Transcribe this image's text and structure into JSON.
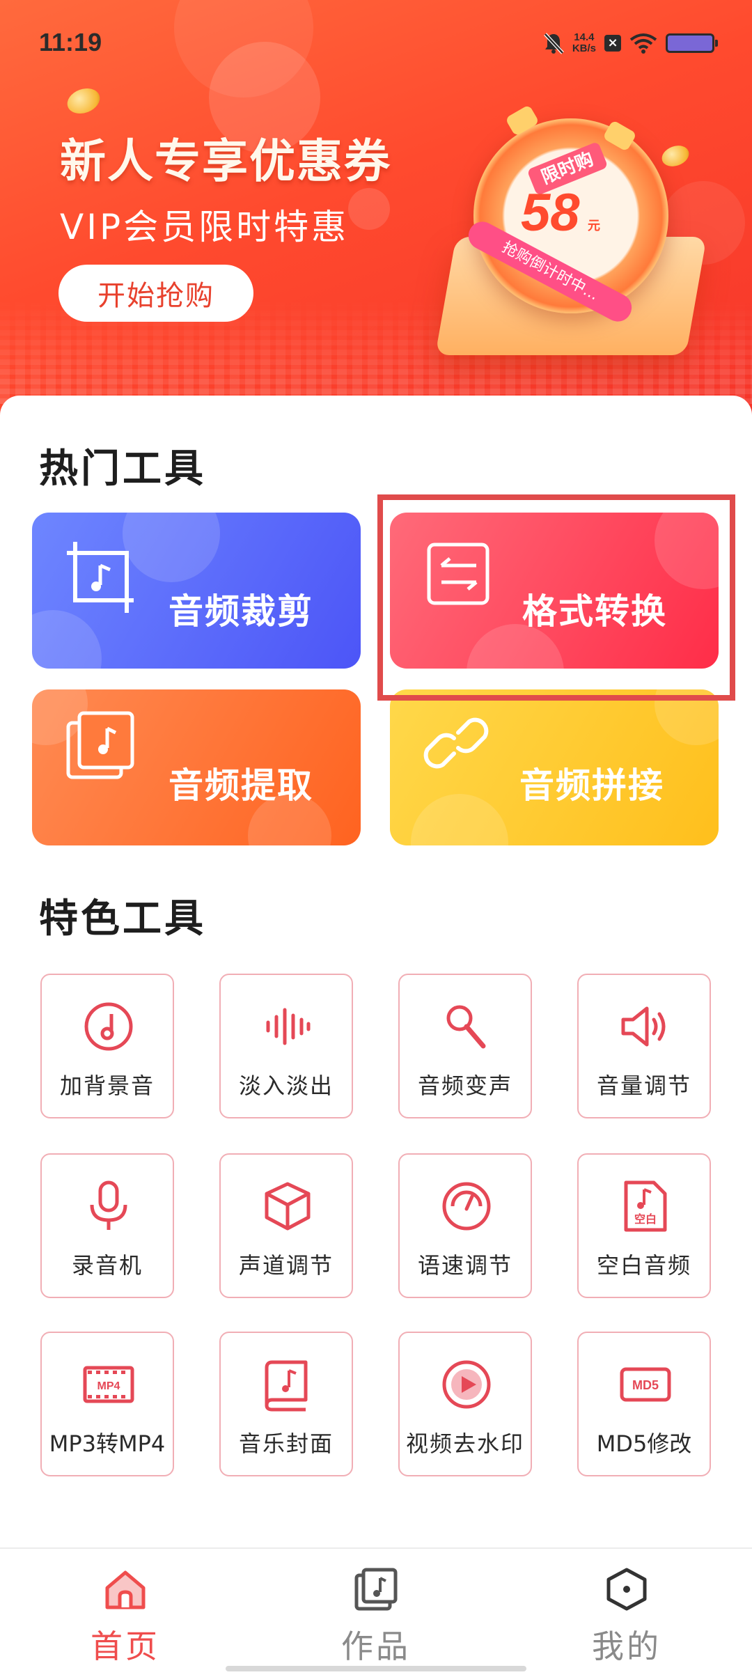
{
  "status_bar": {
    "time": "11:19",
    "net_speed_value": "14.4",
    "net_speed_unit": "KB/s"
  },
  "banner": {
    "title": "新人专享优惠券",
    "subtitle": "VIP会员限时特惠",
    "button_label": "开始抢购",
    "promo_tag": "限时购",
    "promo_price": "58",
    "promo_unit": "元",
    "promo_ribbon": "抢购倒计时中..."
  },
  "hot_tools": {
    "title": "热门工具",
    "items": [
      {
        "label": "音频裁剪",
        "icon": "crop-music-icon"
      },
      {
        "label": "格式转换",
        "icon": "convert-arrows-icon"
      },
      {
        "label": "音频提取",
        "icon": "extract-music-icon"
      },
      {
        "label": "音频拼接",
        "icon": "link-chain-icon"
      }
    ]
  },
  "feature_tools": {
    "title": "特色工具",
    "items": [
      {
        "label": "加背景音",
        "icon": "music-disc-icon"
      },
      {
        "label": "淡入淡出",
        "icon": "waveform-icon"
      },
      {
        "label": "音频变声",
        "icon": "microphone-karaoke-icon"
      },
      {
        "label": "音量调节",
        "icon": "speaker-volume-icon"
      },
      {
        "label": "录音机",
        "icon": "microphone-icon"
      },
      {
        "label": "声道调节",
        "icon": "cube-icon"
      },
      {
        "label": "语速调节",
        "icon": "speedometer-icon"
      },
      {
        "label": "空白音频",
        "icon": "blank-audio-file-icon",
        "icon_text": "空白"
      },
      {
        "label": "MP3转MP4",
        "icon": "mp4-film-icon",
        "icon_text": "MP4"
      },
      {
        "label": "音乐封面",
        "icon": "music-book-icon"
      },
      {
        "label": "视频去水印",
        "icon": "play-circle-icon"
      },
      {
        "label": "MD5修改",
        "icon": "md5-box-icon",
        "icon_text": "MD5"
      }
    ]
  },
  "bottom_nav": {
    "items": [
      {
        "label": "首页",
        "icon": "home-icon",
        "active": true
      },
      {
        "label": "作品",
        "icon": "works-music-icon",
        "active": false
      },
      {
        "label": "我的",
        "icon": "profile-hexagon-icon",
        "active": false
      }
    ]
  },
  "colors": {
    "accent": "#e8412d",
    "nav_active": "#ef4d4d",
    "nav_inactive": "#8a8a8a",
    "tool_icon": "#e54856",
    "tool_border": "#f1aeb5"
  }
}
